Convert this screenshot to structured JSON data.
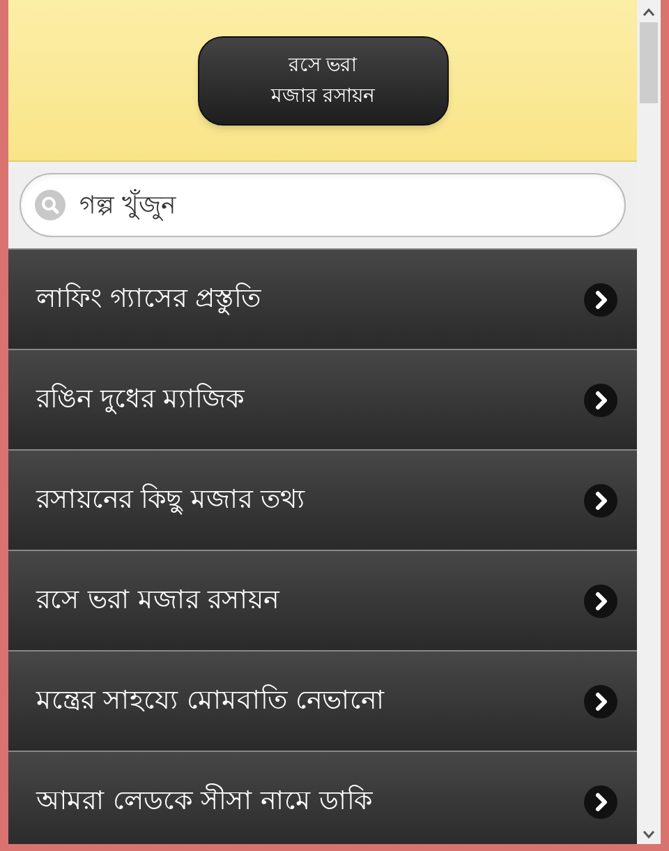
{
  "header": {
    "title_lines": [
      "রসে ভরা",
      "মজার রসায়ন"
    ]
  },
  "search": {
    "placeholder": "গল্প খুঁজুন"
  },
  "stories": [
    {
      "label": "লাফিং গ্যাসের প্রস্তুতি"
    },
    {
      "label": "রঙিন দুধের ম্যাজিক"
    },
    {
      "label": "রসায়নের কিছু মজার তথ্য"
    },
    {
      "label": "রসে ভরা মজার রসায়ন"
    },
    {
      "label": "মন্ত্রের সাহয্যে মোমবাতি নেভানো"
    },
    {
      "label": "আমরা লেডকে সীসা নামে ডাকি"
    }
  ]
}
